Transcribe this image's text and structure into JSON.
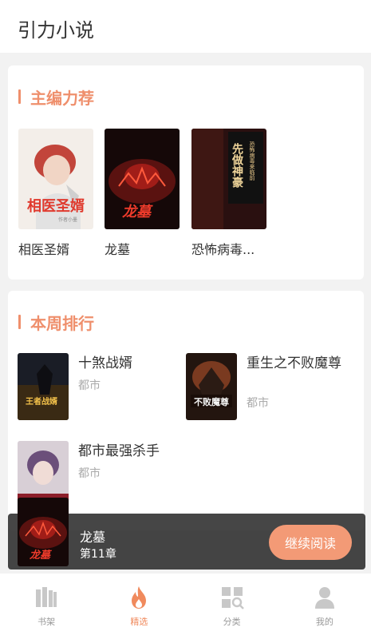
{
  "app_title": "引力小说",
  "recommend": {
    "title": "主编力荐",
    "books": [
      {
        "name": "相医圣婿",
        "cover_text": "相医圣婿",
        "cover_author": "作者小墨"
      },
      {
        "name": "龙墓",
        "cover_text": "龙墓"
      },
      {
        "name": "恐怖病毒...",
        "cover_text": "先做神豪",
        "cover_sub": "恐怖病毒来临前"
      }
    ]
  },
  "ranking": {
    "title": "本周排行",
    "items": [
      {
        "name": "十煞战婿",
        "category": "都市",
        "cover_text": "王者战婿"
      },
      {
        "name": "重生之不败魔尊",
        "category": "都市",
        "cover_text": "不败魔尊"
      },
      {
        "name": "都市最强杀手",
        "category": "都市"
      }
    ]
  },
  "continue_reading": {
    "book": "龙墓",
    "chapter": "第11章",
    "button": "继续阅读",
    "cover_text": "龙墓"
  },
  "tabs": [
    {
      "label": "书架",
      "icon": "bookshelf-icon"
    },
    {
      "label": "精选",
      "icon": "flame-icon",
      "active": true
    },
    {
      "label": "分类",
      "icon": "category-icon"
    },
    {
      "label": "我的",
      "icon": "user-icon"
    }
  ],
  "colors": {
    "accent": "#ef8f6c",
    "button": "#f39a76",
    "overlay": "#282828"
  }
}
